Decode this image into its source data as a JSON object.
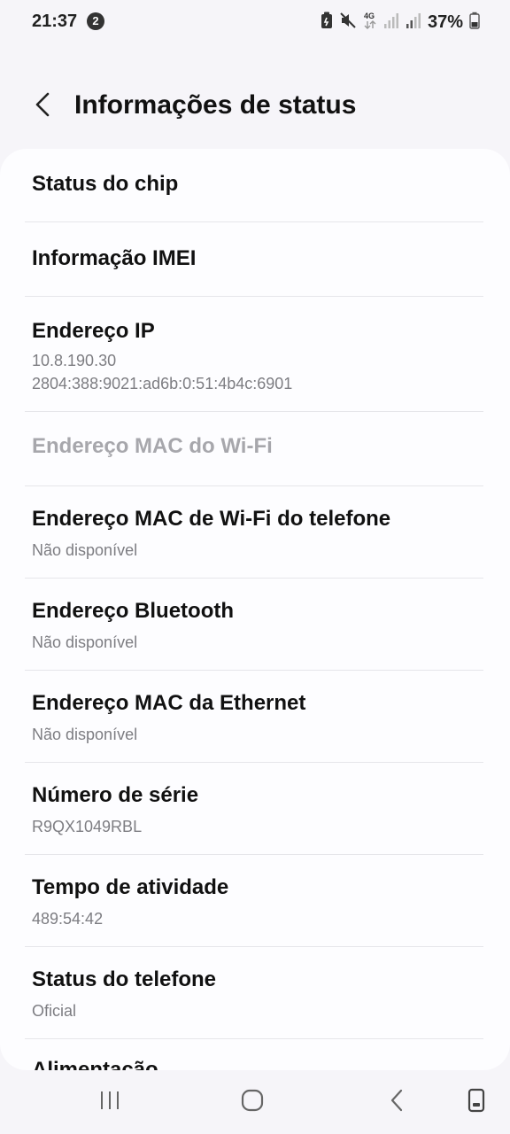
{
  "status_bar": {
    "time": "21:37",
    "notification_count": "2",
    "battery_percent": "37%",
    "icons": [
      "battery-saver-icon",
      "mute-icon",
      "4g-data-icon",
      "signal-icon",
      "signal-icon",
      "battery-icon"
    ]
  },
  "header": {
    "back_icon": "chevron-left-icon",
    "title": "Informações de status"
  },
  "items": [
    {
      "title": "Status do chip",
      "subtitle": ""
    },
    {
      "title": "Informação IMEI",
      "subtitle": ""
    },
    {
      "title": "Endereço IP",
      "subtitle": "10.8.190.30",
      "subtitle2": "2804:388:9021:ad6b:0:51:4b4c:6901"
    },
    {
      "title": "Endereço MAC do Wi-Fi",
      "subtitle": "",
      "disabled": true
    },
    {
      "title": "Endereço MAC de Wi-Fi do telefone",
      "subtitle": "Não disponível"
    },
    {
      "title": "Endereço Bluetooth",
      "subtitle": "Não disponível"
    },
    {
      "title": "Endereço MAC da Ethernet",
      "subtitle": "Não disponível"
    },
    {
      "title": "Número de série",
      "subtitle": "R9QX1049RBL"
    },
    {
      "title": "Tempo de atividade",
      "subtitle": "489:54:42"
    },
    {
      "title": "Status do telefone",
      "subtitle": "Oficial"
    },
    {
      "title": "Alimentação",
      "subtitle": ""
    }
  ],
  "nav_bar": {
    "icons": [
      "recent-apps-icon",
      "home-icon",
      "back-icon",
      "screen-pin-icon"
    ]
  },
  "colors": {
    "background": "#f6f5f9",
    "card": "#fdfdff",
    "title_text": "#111111",
    "subtitle_text": "#7d7d82",
    "disabled_text": "#a7a7ac"
  }
}
